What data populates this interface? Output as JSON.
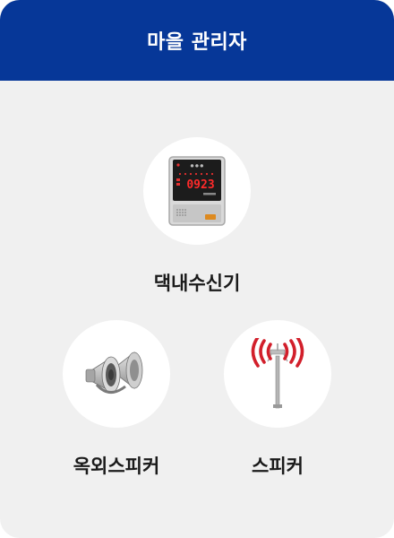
{
  "header": {
    "title": "마을 관리자"
  },
  "devices": [
    {
      "label": "댁내수신기",
      "icon": "receiver-icon",
      "display_value": "0923"
    },
    {
      "label": "옥외스피커",
      "icon": "outdoor-speaker-icon"
    },
    {
      "label": "스피커",
      "icon": "speaker-antenna-icon"
    }
  ],
  "colors": {
    "header": "#063798",
    "background": "#f0f0f0",
    "display": "#e02020"
  }
}
